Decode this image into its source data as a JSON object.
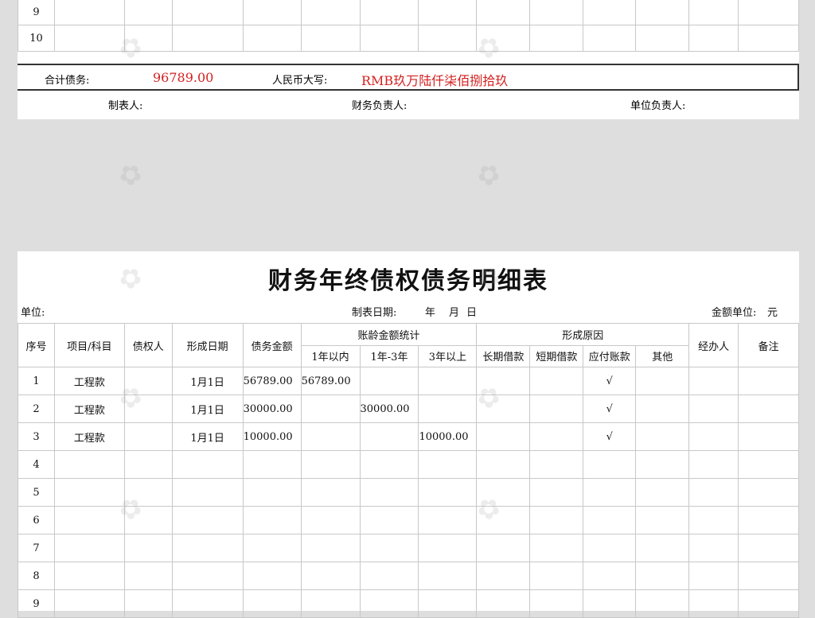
{
  "top": {
    "rows": [
      {
        "no": "9"
      },
      {
        "no": "10"
      }
    ],
    "total_label": "合计债务:",
    "total_value": "96789.00",
    "rmb_label": "人民币大写:",
    "rmb_value": "RMB玖万陆仟柒佰捌拾玖",
    "preparer_label": "制表人:",
    "finance_head_label": "财务负责人:",
    "unit_head_label": "单位负责人:"
  },
  "main": {
    "title": "财务年终债权债务明细表",
    "unit_label": "单位:",
    "date_label": "制表日期:",
    "date_year": "年",
    "date_month": "月",
    "date_day": "日",
    "currency_label": "金额单位:",
    "currency_value": "元",
    "headers": {
      "no": "序号",
      "item": "项目/科目",
      "creditor": "债权人",
      "date": "形成日期",
      "amount": "债务金额",
      "aging": "账龄金额统计",
      "aging_1": "1年以内",
      "aging_2": "1年-3年",
      "aging_3": "3年以上",
      "cause": "形成原因",
      "cause_1": "长期借款",
      "cause_2": "短期借款",
      "cause_3": "应付账款",
      "cause_4": "其他",
      "handler": "经办人",
      "remark": "备注"
    },
    "rows": [
      {
        "no": "1",
        "item": "工程款",
        "date": "1月1日",
        "amount": "56789.00",
        "a1": "56789.00",
        "a2": "",
        "a3": "",
        "c3": "√"
      },
      {
        "no": "2",
        "item": "工程款",
        "date": "1月1日",
        "amount": "30000.00",
        "a1": "",
        "a2": "30000.00",
        "a3": "",
        "c3": "√"
      },
      {
        "no": "3",
        "item": "工程款",
        "date": "1月1日",
        "amount": "10000.00",
        "a1": "",
        "a2": "",
        "a3": "10000.00",
        "c3": "√"
      },
      {
        "no": "4"
      },
      {
        "no": "5"
      },
      {
        "no": "6"
      },
      {
        "no": "7"
      },
      {
        "no": "8"
      },
      {
        "no": "9"
      }
    ]
  }
}
